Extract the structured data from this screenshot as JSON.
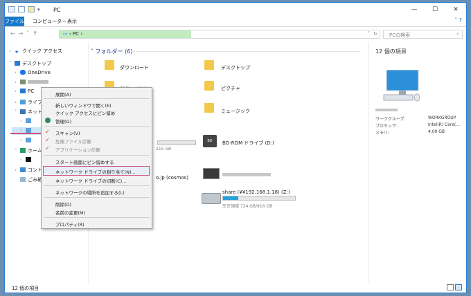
{
  "window": {
    "title": "PC",
    "ribbon_tabs": [
      "ファイル",
      "コンピューター",
      "表示"
    ],
    "address": "PC",
    "search_placeholder": "PCの検索"
  },
  "nav": {
    "items": [
      {
        "label": "クイック アクセス"
      },
      {
        "label": "デスクトップ"
      },
      {
        "label": "OneDrive"
      },
      {
        "label": "PC"
      },
      {
        "label": "ライブラリ"
      },
      {
        "label": "ネットワーク"
      },
      {
        "label": "ホームグ"
      },
      {
        "label": "コントロ"
      },
      {
        "label": "ごみ箱"
      }
    ]
  },
  "content": {
    "folders_heading": "フォルダー (6)",
    "folders": [
      "ダウンロード",
      "デスクトップ",
      "ドキュメント",
      "ピクチャ",
      "ミュージック"
    ],
    "drive_partial_size": "215 GB",
    "bd_drive": "BD-ROM ドライブ (D:)",
    "network_partial": "o.jp (cosmos)",
    "share_name": "share (¥¥192.168.1.18) (Z:)",
    "share_space": "空き領域 724 GB/916 GB",
    "share_fill_percent": 21
  },
  "details": {
    "count": "12 個の項目",
    "workgroup_label": "ワークグループ:",
    "workgroup_value": "WORKGROUP",
    "processor_label": "プロセッサ:",
    "processor_value": "Intel(R) Core(...",
    "memory_label": "メモリ:",
    "memory_value": "4.00 GB"
  },
  "status": {
    "count": "12 個の項目"
  },
  "context_menu": {
    "items": [
      "展開(A)",
      "新しいウィンドウで開く(E)",
      "クイック アクセスにピン留め",
      "管理(G)",
      "スキャン(V)",
      "危険ファイル診断",
      "アプリケーション診断",
      "スタート画面にピン留めする",
      "ネットワーク ドライブの割り当て(N)...",
      "ネットワーク ドライブの切断(C)...",
      "ネットワークの場所を追加する(L)",
      "削除(D)",
      "名前の変更(M)",
      "プロパティ(R)"
    ]
  }
}
